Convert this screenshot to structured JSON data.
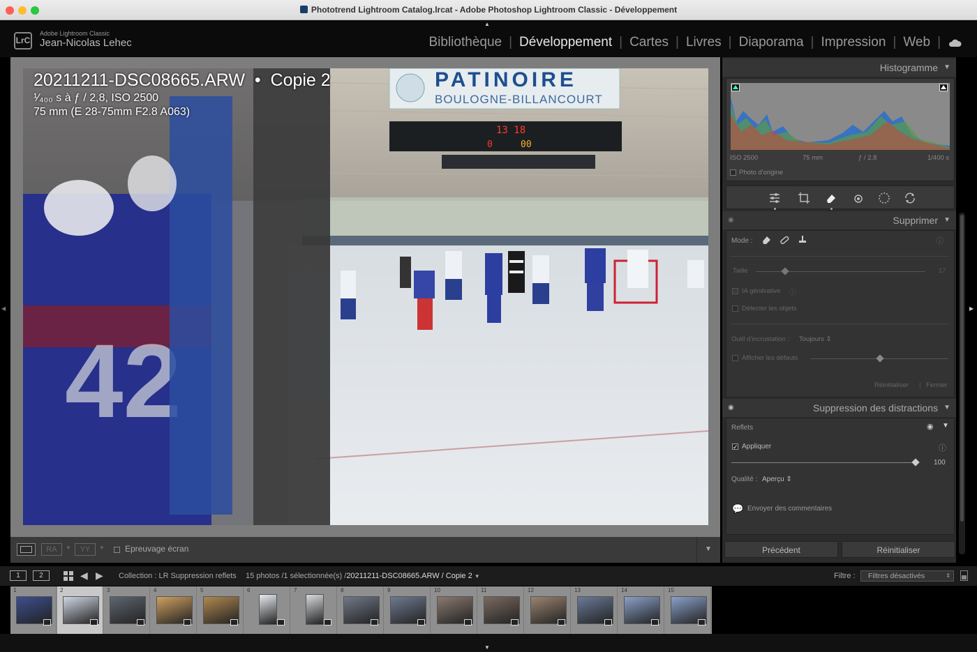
{
  "window": {
    "title": "Phototrend Lightroom Catalog.lrcat - Adobe Photoshop Lightroom Classic - Développement"
  },
  "header": {
    "logo": "LrC",
    "app_name": "Adobe Lightroom Classic",
    "user": "Jean-Nicolas Lehec",
    "modules": [
      "Bibliothèque",
      "Développement",
      "Cartes",
      "Livres",
      "Diaporama",
      "Impression",
      "Web"
    ],
    "active_module": "Développement"
  },
  "photo": {
    "filename": "20211211-DSC08665.ARW",
    "copy": "Copie 2",
    "exif_line1": "¹⁄₄₀₀ s à ƒ / 2,8, ISO 2500",
    "exif_line2": "75 mm (E 28-75mm F2.8 A063)",
    "scoreboard": {
      "banner_top": "PATINOIRE",
      "banner_bottom": "BOULOGNE-BILLANCOURT",
      "time": "13 18",
      "home": "0",
      "away": "00"
    }
  },
  "histogram": {
    "title": "Histogramme",
    "iso": "ISO 2500",
    "focal": "75 mm",
    "aperture": "ƒ / 2,8",
    "shutter": "1/400 s",
    "original_label": "Photo d'origine"
  },
  "remove": {
    "title": "Supprimer",
    "mode_label": "Mode :",
    "size_label": "Taille",
    "size_value": "17",
    "gen_ai": "IA générative",
    "detect": "Détecter les objets",
    "overlay_label": "Outil d'incrustation :",
    "overlay_value": "Toujours",
    "show_defaults": "Afficher les défauts",
    "reset": "Réinitialiser",
    "close": "Fermer"
  },
  "distractions": {
    "title": "Suppression des distractions",
    "reflets": "Reflets",
    "apply": "Appliquer",
    "amount": "100",
    "quality_label": "Qualité :",
    "quality_value": "Aperçu",
    "feedback": "Envoyer des commentaires"
  },
  "buttons": {
    "previous": "Précédent",
    "reset": "Réinitialiser"
  },
  "toolbar": {
    "softproof": "Epreuvage écran"
  },
  "filmstrip_bar": {
    "view1": "1",
    "view2": "2",
    "collection": "Collection : LR Suppression reflets",
    "count": "15 photos /1 sélectionnée(s) /",
    "current": "20211211-DSC08665.ARW / Copie 2",
    "filter_label": "Filtre :",
    "filter_value": "Filtres désactivés"
  },
  "filmstrip": {
    "items": [
      "1",
      "2",
      "3",
      "4",
      "5",
      "6",
      "7",
      "8",
      "9",
      "10",
      "11",
      "12",
      "13",
      "14",
      "15"
    ],
    "selected": "2"
  }
}
